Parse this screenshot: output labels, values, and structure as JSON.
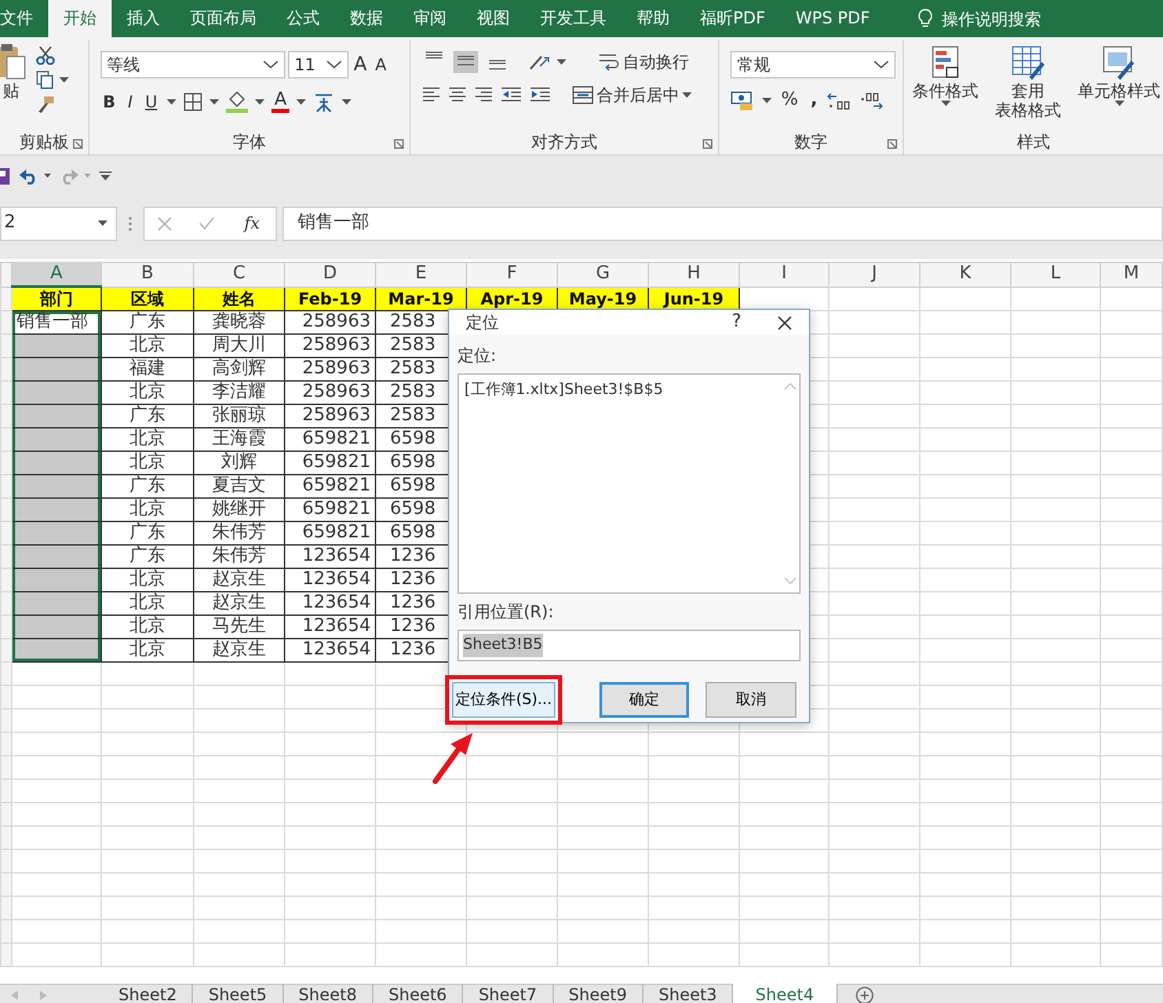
{
  "ribbon_tabs": [
    {
      "label": "文件",
      "selected": false
    },
    {
      "label": "开始",
      "selected": true
    },
    {
      "label": "插入",
      "selected": false
    },
    {
      "label": "页面布局",
      "selected": false
    },
    {
      "label": "公式",
      "selected": false
    },
    {
      "label": "数据",
      "selected": false
    },
    {
      "label": "审阅",
      "selected": false
    },
    {
      "label": "视图",
      "selected": false
    },
    {
      "label": "开发工具",
      "selected": false
    },
    {
      "label": "帮助",
      "selected": false
    },
    {
      "label": "福昕PDF",
      "selected": false
    },
    {
      "label": "WPS PDF",
      "selected": false
    }
  ],
  "tell_me": "操作说明搜索",
  "ribbon": {
    "paste": "贴",
    "font_name": "等线",
    "font_size": "11",
    "grow_font": "A",
    "shrink_font": "A",
    "bold": "B",
    "italic": "I",
    "underline": "U",
    "font_color": "A",
    "wrap_text": "自动换行",
    "merge_center": "合并后居中",
    "number_format": "常规",
    "percent": "%",
    "comma": ",",
    "conditional_format": "条件格式",
    "format_as_table": [
      "套用",
      "表格格式"
    ],
    "cell_styles": "单元格样式",
    "vertical_align": [
      {
        "selected": false
      },
      {
        "selected": true
      },
      {
        "selected": false
      }
    ],
    "group_labels": [
      "剪贴板",
      "字体",
      "对齐方式",
      "数字",
      "样式"
    ]
  },
  "formula_bar": {
    "name_box": "2",
    "fx": "fx",
    "value": "销售一部"
  },
  "columns": [
    {
      "label": "A",
      "selected": true
    },
    {
      "label": "B",
      "selected": false
    },
    {
      "label": "C",
      "selected": false
    },
    {
      "label": "D",
      "selected": false
    },
    {
      "label": "E",
      "selected": false
    },
    {
      "label": "F",
      "selected": false
    },
    {
      "label": "G",
      "selected": false
    },
    {
      "label": "H",
      "selected": false
    },
    {
      "label": "I",
      "selected": false
    },
    {
      "label": "J",
      "selected": false
    },
    {
      "label": "K",
      "selected": false
    },
    {
      "label": "L",
      "selected": false
    },
    {
      "label": "M",
      "selected": false
    }
  ],
  "table": {
    "header": [
      "部门",
      "区域",
      "姓名",
      "Feb-19",
      "Mar-19",
      "Apr-19",
      "May-19",
      "Jun-19"
    ],
    "rows": [
      {
        "dept": "销售一部",
        "cells": [
          "广东",
          "龚晓蓉",
          "258963",
          "2583"
        ],
        "selected": false
      },
      {
        "cells": [
          "北京",
          "周大川",
          "258963",
          "2583"
        ],
        "selected": true
      },
      {
        "cells": [
          "福建",
          "高剑辉",
          "258963",
          "2583"
        ],
        "selected": true
      },
      {
        "cells": [
          "北京",
          "李洁耀",
          "258963",
          "2583"
        ],
        "selected": true
      },
      {
        "cells": [
          "广东",
          "张丽琼",
          "258963",
          "2583"
        ],
        "selected": true
      },
      {
        "cells": [
          "北京",
          "王海霞",
          "659821",
          "6598"
        ],
        "selected": true
      },
      {
        "cells": [
          "北京",
          "刘辉",
          "659821",
          "6598"
        ],
        "selected": true
      },
      {
        "cells": [
          "广东",
          "夏吉文",
          "659821",
          "6598"
        ],
        "selected": true
      },
      {
        "cells": [
          "北京",
          "姚继开",
          "659821",
          "6598"
        ],
        "selected": true
      },
      {
        "cells": [
          "广东",
          "朱伟芳",
          "659821",
          "6598"
        ],
        "selected": true
      },
      {
        "cells": [
          "广东",
          "朱伟芳",
          "123654",
          "1236"
        ],
        "selected": true
      },
      {
        "cells": [
          "北京",
          "赵京生",
          "123654",
          "1236"
        ],
        "selected": true
      },
      {
        "cells": [
          "北京",
          "赵京生",
          "123654",
          "1236"
        ],
        "selected": true
      },
      {
        "cells": [
          "北京",
          "马先生",
          "123654",
          "1236"
        ],
        "selected": true
      },
      {
        "cells": [
          "北京",
          "赵京生",
          "123654",
          "1236"
        ],
        "selected": true
      }
    ]
  },
  "dialog": {
    "title": "定位",
    "help": "?",
    "list_label": "定位:",
    "list_items": [
      "[工作簿1.xltx]Sheet3!$B$5"
    ],
    "ref_label": "引用位置(R):",
    "ref_value": "Sheet3!B5",
    "ref_value_selected": true,
    "buttons": [
      {
        "label": "定位条件(S)...",
        "highlighted": true,
        "default": false
      },
      {
        "label": "确定",
        "highlighted": false,
        "default": true
      },
      {
        "label": "取消",
        "highlighted": false,
        "default": false
      }
    ]
  },
  "sheet_tabs": [
    {
      "label": "Sheet2",
      "selected": false
    },
    {
      "label": "Sheet5",
      "selected": false
    },
    {
      "label": "Sheet8",
      "selected": false
    },
    {
      "label": "Sheet6",
      "selected": false
    },
    {
      "label": "Sheet7",
      "selected": false
    },
    {
      "label": "Sheet9",
      "selected": false
    },
    {
      "label": "Sheet3",
      "selected": false
    },
    {
      "label": "Sheet4",
      "selected": true
    }
  ]
}
